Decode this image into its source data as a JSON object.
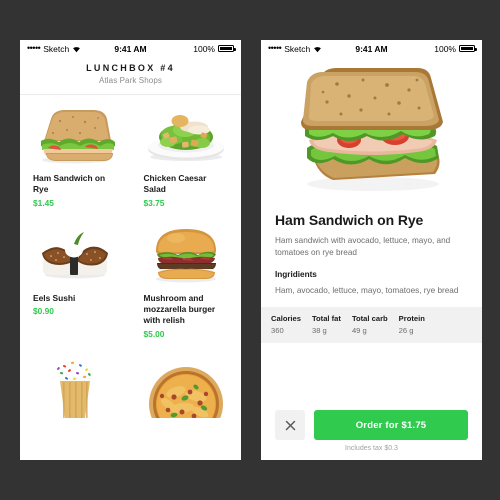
{
  "theme": {
    "background": "#333333",
    "accent_green": "#2fca4e",
    "panel": "#ffffff",
    "muted_text": "#6d6d6d",
    "nutrition_bg": "#f1f1f1"
  },
  "status_bar": {
    "signal_dots": "•••••",
    "carrier": "Sketch",
    "wifi_icon": "wifi-icon",
    "time": "9:41 AM",
    "battery_percent": "100%",
    "battery_icon": "battery-full-icon"
  },
  "list_screen": {
    "header": {
      "title": "LUNCHBOX #4",
      "subtitle": "Atlas Park Shops"
    },
    "products": [
      {
        "image": "ham-sandwich-photo",
        "name": "Ham Sandwich on Rye",
        "price": "$1.45"
      },
      {
        "image": "chicken-caesar-salad-photo",
        "name": "Chicken Caesar Salad",
        "price": "$3.75"
      },
      {
        "image": "eels-sushi-photo",
        "name": "Eels Sushi",
        "price": "$0.90"
      },
      {
        "image": "mushroom-burger-photo",
        "name": "Mushroom and mozzarella burger with relish",
        "price": "$5.00"
      },
      {
        "image": "cupcake-photo",
        "name": "",
        "price": ""
      },
      {
        "image": "pizza-photo",
        "name": "",
        "price": ""
      }
    ]
  },
  "detail_screen": {
    "hero_image": "ham-sandwich-hero-photo",
    "title": "Ham Sandwich on Rye",
    "description": "Ham sandwich with avocado, lettuce, mayo, and tomatoes on rye bread",
    "ingredients_heading": "Ingridients",
    "ingredients": "Ham, avocado, lettuce, mayo, tomatoes, rye bread",
    "nutrition": [
      {
        "label": "Calories",
        "value": "360"
      },
      {
        "label": "Total fat",
        "value": "38 g"
      },
      {
        "label": "Total carb",
        "value": "49 g"
      },
      {
        "label": "Protein",
        "value": "26 g"
      }
    ],
    "close_label": "close-icon",
    "order_button": "Order for $1.75",
    "tax_note": "Includes tax $0.3"
  }
}
